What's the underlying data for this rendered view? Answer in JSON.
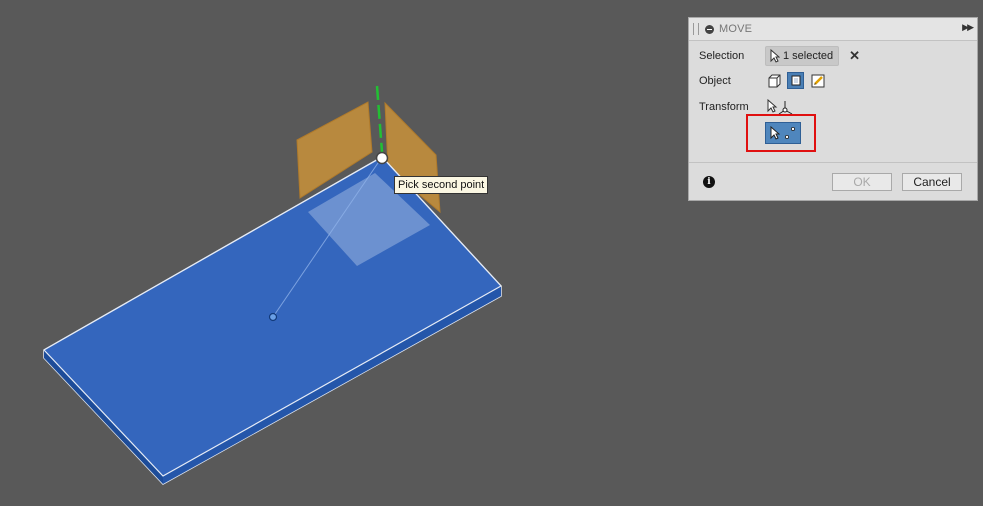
{
  "viewport": {
    "tooltip": "Pick second point"
  },
  "dialog": {
    "title": "MOVE",
    "selection_label": "Selection",
    "selection_value": "1 selected",
    "object_label": "Object",
    "transform_label": "Transform",
    "ok_label": "OK",
    "cancel_label": "Cancel",
    "icons": {
      "collapse": "collapse-icon",
      "expand": "double-chevron-right-icon",
      "clear": "close-icon",
      "info": "info-icon"
    }
  },
  "colors": {
    "body_blue": "#2f63b8",
    "plane_orange": "#c9923a",
    "axis_green": "#22c033",
    "highlight_red": "#e01010"
  }
}
